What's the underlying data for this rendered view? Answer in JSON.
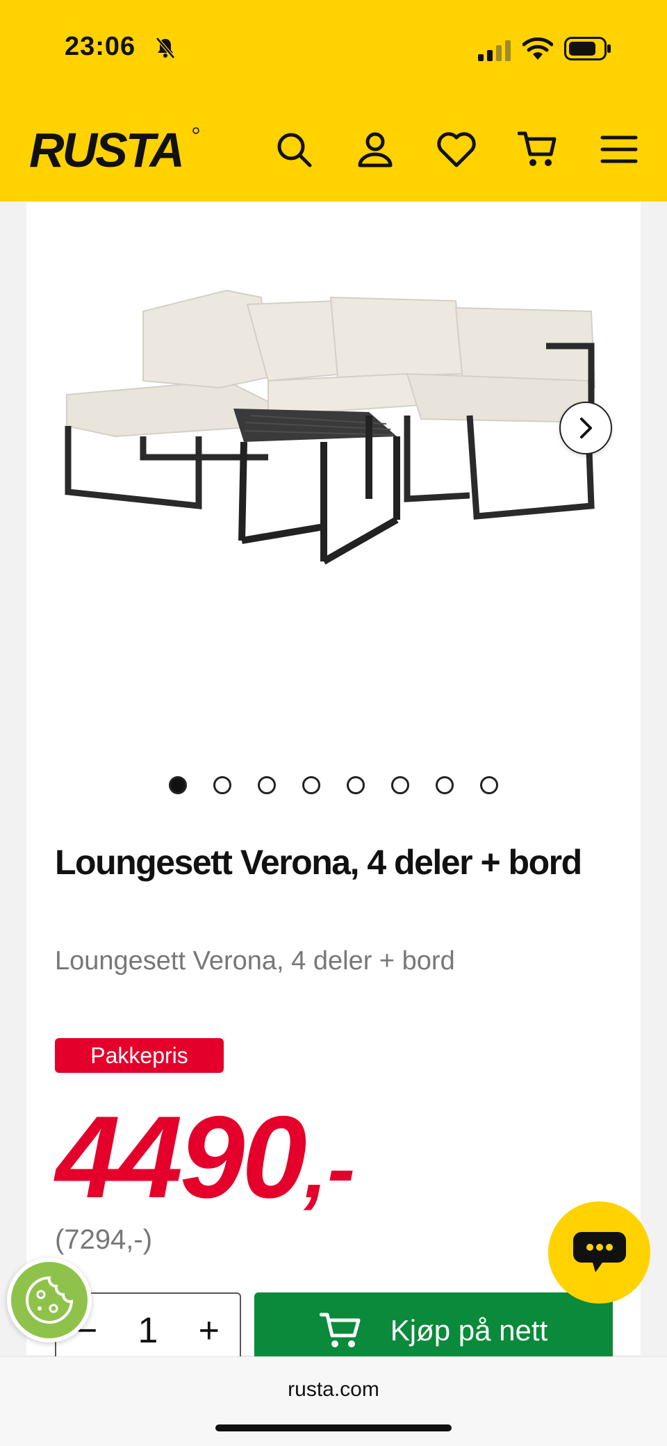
{
  "status_bar": {
    "time": "23:06"
  },
  "header": {
    "logo_text": "RUSTA",
    "brand_color": "#ffd200",
    "icons": [
      "search-icon",
      "account-icon",
      "heart-icon",
      "cart-icon",
      "menu-icon"
    ]
  },
  "gallery": {
    "total_images": 8,
    "active_index": 0
  },
  "product": {
    "title": "Loungesett Verona, 4 deler + bord",
    "subtitle": "Loungesett Verona, 4 deler + bord",
    "badge": "Pakkepris",
    "price": "4490",
    "price_suffix": ",-",
    "old_price": "(7294,-)",
    "price_color": "#e4002b"
  },
  "purchase": {
    "quantity": "1",
    "minus": "−",
    "plus": "+",
    "buy_label": "Kjøp på nett",
    "buy_color": "#0a8a3a"
  },
  "browser": {
    "url": "rusta.com"
  }
}
